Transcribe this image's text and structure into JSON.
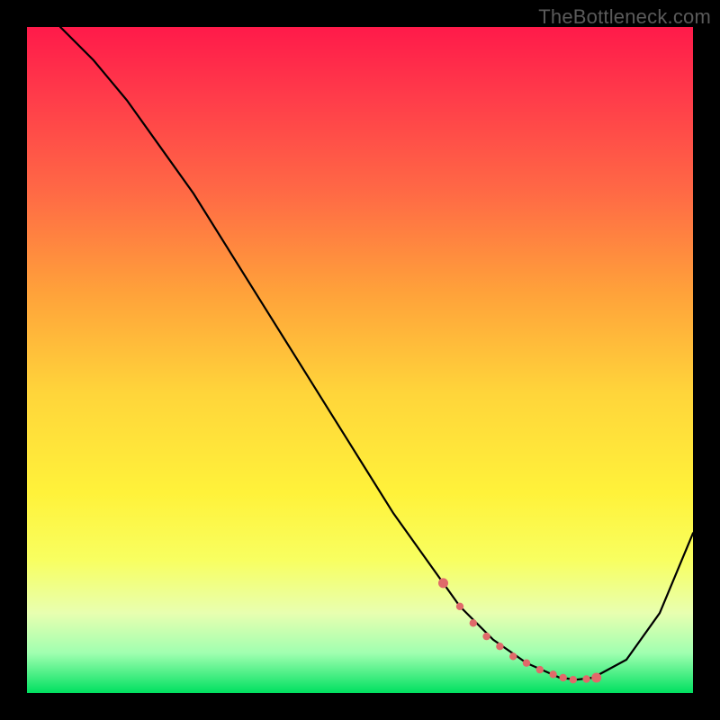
{
  "watermark": "TheBottleneck.com",
  "chart_data": {
    "type": "line",
    "title": "",
    "xlabel": "",
    "ylabel": "",
    "xlim": [
      0,
      100
    ],
    "ylim": [
      0,
      100
    ],
    "series": [
      {
        "name": "curve",
        "x": [
          5,
          10,
          15,
          20,
          25,
          30,
          35,
          40,
          45,
          50,
          55,
          60,
          62.5,
          65,
          70,
          75,
          80,
          82.5,
          85,
          90,
          95,
          100
        ],
        "y": [
          100,
          95,
          89,
          82,
          75,
          67,
          59,
          51,
          43,
          35,
          27,
          20,
          16.5,
          13,
          8,
          4.5,
          2.3,
          2,
          2.3,
          5,
          12,
          24
        ]
      }
    ],
    "markers": {
      "name": "trough-dots",
      "color": "#e06a6a",
      "x": [
        62.5,
        65,
        67,
        69,
        71,
        73,
        75,
        77,
        79,
        80.5,
        82,
        84,
        85.5
      ],
      "y": [
        16.5,
        13,
        10.5,
        8.5,
        7,
        5.5,
        4.5,
        3.5,
        2.8,
        2.3,
        2,
        2.1,
        2.3
      ]
    }
  }
}
